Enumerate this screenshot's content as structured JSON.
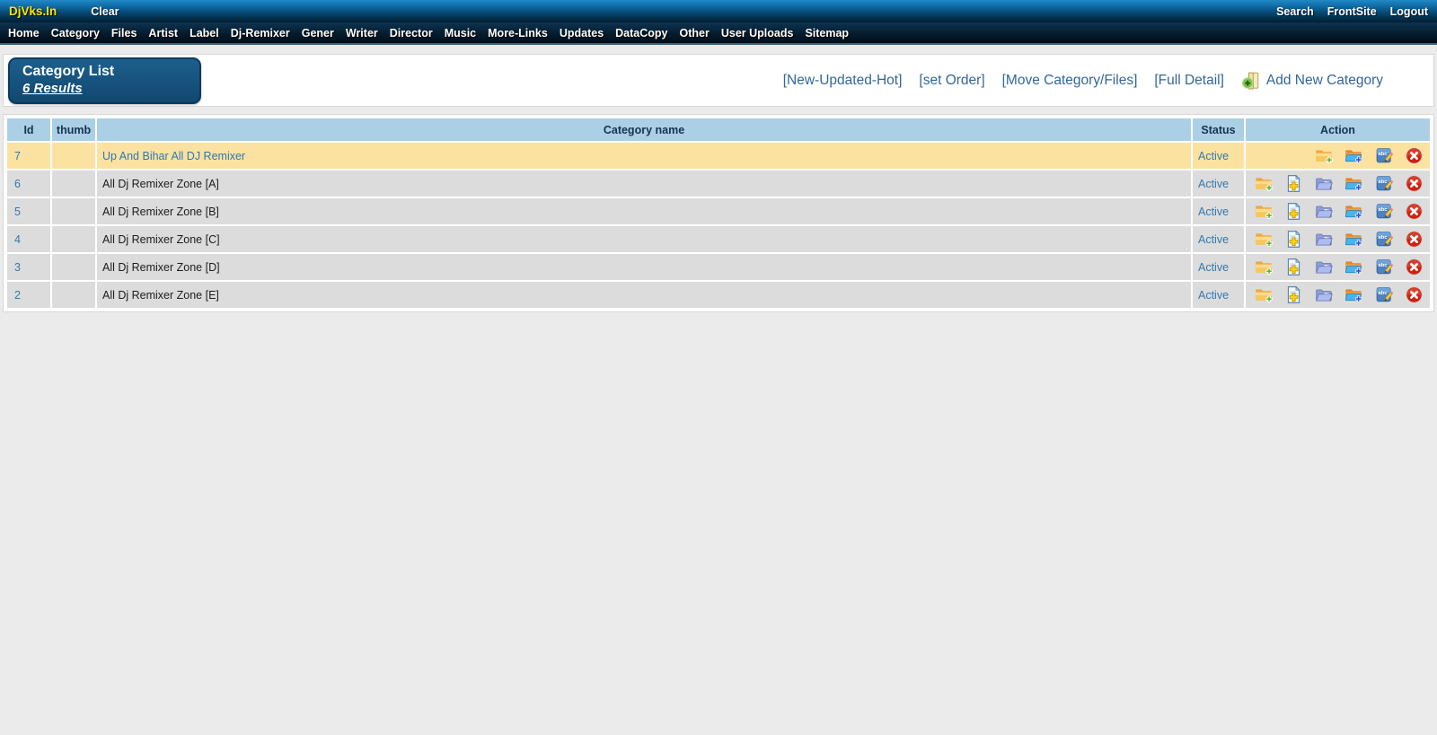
{
  "topbar": {
    "brand": "DjVks.In",
    "clear": "Clear",
    "links": {
      "search": "Search",
      "frontsite": "FrontSite",
      "logout": "Logout"
    }
  },
  "nav": {
    "items": [
      "Home",
      "Category",
      "Files",
      "Artist",
      "Label",
      "Dj-Remixer",
      "Gener",
      "Writer",
      "Director",
      "Music",
      "More-Links",
      "Updates",
      "DataCopy",
      "Other",
      "User Uploads",
      "Sitemap"
    ]
  },
  "header": {
    "title": "Category List",
    "results": "6 Results",
    "links": [
      "[New-Updated-Hot]",
      "[set Order]",
      "[Move Category/Files]",
      "[Full Detail]"
    ],
    "add_new_label": "Add New Category",
    "add_new_icon": "folder-plus-icon"
  },
  "table": {
    "columns": [
      "Id",
      "thumb",
      "Category name",
      "Status",
      "Action"
    ],
    "rows": [
      {
        "id": "7",
        "thumb": "",
        "name": "Up And Bihar All DJ Remixer",
        "status": "Active",
        "highlighted": true,
        "actions": [
          "folder-add-icon",
          "folder-new-icon",
          "edit-icon",
          "delete-icon"
        ]
      },
      {
        "id": "6",
        "thumb": "",
        "name": "All Dj Remixer Zone [A]",
        "status": "Active",
        "highlighted": false,
        "actions": [
          "folder-add-icon",
          "file-add-icon",
          "folder-open-icon",
          "folder-new-icon",
          "edit-icon",
          "delete-icon"
        ]
      },
      {
        "id": "5",
        "thumb": "",
        "name": "All Dj Remixer Zone [B]",
        "status": "Active",
        "highlighted": false,
        "actions": [
          "folder-add-icon",
          "file-add-icon",
          "folder-open-icon",
          "folder-new-icon",
          "edit-icon",
          "delete-icon"
        ]
      },
      {
        "id": "4",
        "thumb": "",
        "name": "All Dj Remixer Zone [C]",
        "status": "Active",
        "highlighted": false,
        "actions": [
          "folder-add-icon",
          "file-add-icon",
          "folder-open-icon",
          "folder-new-icon",
          "edit-icon",
          "delete-icon"
        ]
      },
      {
        "id": "3",
        "thumb": "",
        "name": "All Dj Remixer Zone [D]",
        "status": "Active",
        "highlighted": false,
        "actions": [
          "folder-add-icon",
          "file-add-icon",
          "folder-open-icon",
          "folder-new-icon",
          "edit-icon",
          "delete-icon"
        ]
      },
      {
        "id": "2",
        "thumb": "",
        "name": "All Dj Remixer Zone [E]",
        "status": "Active",
        "highlighted": false,
        "actions": [
          "folder-add-icon",
          "file-add-icon",
          "folder-open-icon",
          "folder-new-icon",
          "edit-icon",
          "delete-icon"
        ]
      }
    ]
  },
  "colors": {
    "accent_link_blue": "#336699",
    "table_header_bg": "#abcfe5",
    "highlight_row_bg": "#fbe2a1",
    "row_bg": "#dcdcdc",
    "brand_yellow": "#ffe400",
    "title_box_bg": "#11486f",
    "page_bg": "#ebebeb"
  }
}
